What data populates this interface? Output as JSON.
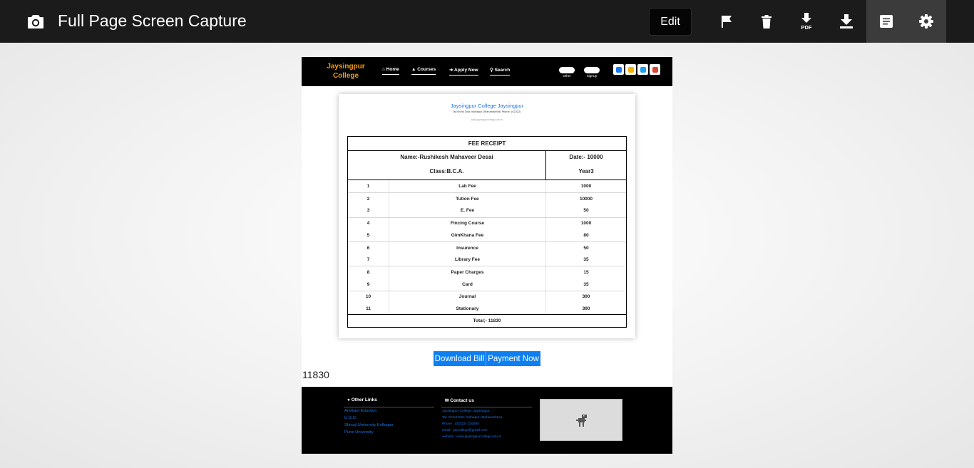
{
  "toolbar": {
    "title": "Full Page Screen Capture",
    "edit_label": "Edit",
    "icons": [
      "camera-icon",
      "flag-icon",
      "trash-icon",
      "download-pdf-icon",
      "download-icon",
      "notes-icon",
      "gear-icon"
    ],
    "pdf_label": "PDF"
  },
  "site": {
    "logo": "Jaysingpur College",
    "nav": [
      "Home",
      "Courses",
      "Apply Now",
      "Search"
    ],
    "pills": [
      "Other",
      "SignUp"
    ],
    "social_colors": [
      "#1877f2",
      "#f4b400",
      "#1da1f2",
      "#db4437"
    ]
  },
  "receipt": {
    "college_name": "Jaysingpur College Jaysingpur",
    "address": "Tal:Shirol Dist: Kolhapur (Maharashtra) Phone: (02322)",
    "website": "www.jaysingpurcollege.edu.in",
    "title": "FEE RECEIPT",
    "name": "Name:-Rushikesh Mahaveer Desai",
    "date": "Date:- 10000",
    "class": "Class:B.C.A.",
    "year": "Year3",
    "rows": [
      {
        "no": "1",
        "item": "Lab Fee",
        "amount": "1000"
      },
      {
        "no": "2",
        "item": "Tution Fee",
        "amount": "10000"
      },
      {
        "no": "3",
        "item": "E. Fee",
        "amount": "50"
      },
      {
        "no": "4",
        "item": "Fincing Course",
        "amount": "1000"
      },
      {
        "no": "5",
        "item": "GimKhana Fee",
        "amount": "80"
      },
      {
        "no": "6",
        "item": "Insurence",
        "amount": "50"
      },
      {
        "no": "7",
        "item": "Library Fee",
        "amount": "35"
      },
      {
        "no": "8",
        "item": "Paper Charges",
        "amount": "15"
      },
      {
        "no": "9",
        "item": "Card",
        "amount": "35"
      },
      {
        "no": "10",
        "item": "Journal",
        "amount": "300"
      },
      {
        "no": "11",
        "item": "Stationary",
        "amount": "300"
      }
    ],
    "total": "Total;- 11830"
  },
  "actions": {
    "download": "Download Bill",
    "pay": "Payment Now",
    "total_value": "11830"
  },
  "footer": {
    "links_heading": "Other Links",
    "links": [
      "Anekant Eduction",
      "U.G.C.",
      "Shivaji University Kolhapur",
      "Pune University"
    ],
    "contact_heading": "Contact us",
    "contact": [
      "Jaysingpur College, Jaysingpur",
      "Tal: Shirol Dist: Kolhapur (Maharashtra)",
      "Phone : (02322) 225280",
      "email : jspcollege@gmail.com",
      "website : www.jaysingpurcollege.edu.in"
    ]
  }
}
